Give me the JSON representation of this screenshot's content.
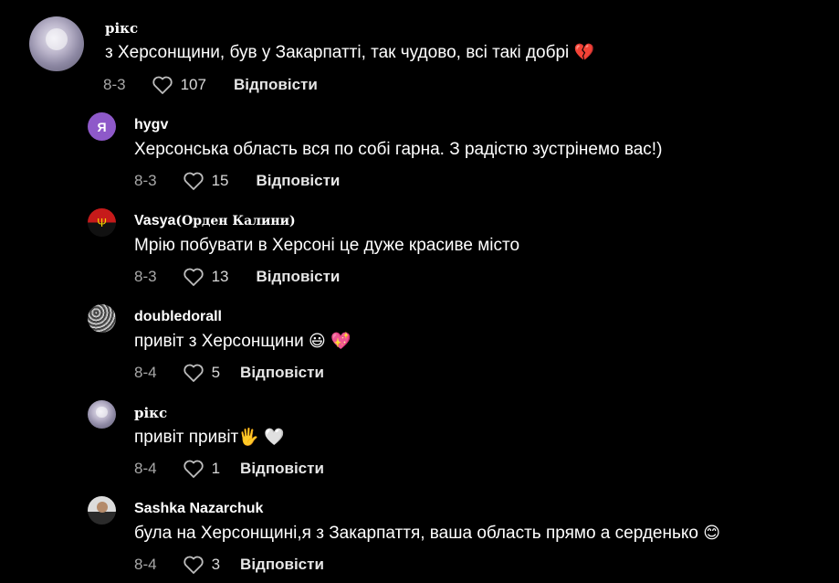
{
  "comments": [
    {
      "user": "рікс",
      "text": "з Херсонщини, був у Закарпатті, так чудово, всі такі добрі",
      "emoji": "💔",
      "date": "8-3",
      "likes": "107",
      "reply": "Відповісти"
    },
    {
      "user": "hygv",
      "avatar_letter": "Я",
      "text": "Херсонська область вся по собі гарна. З радістю зустрінемо вас!)",
      "date": "8-3",
      "likes": "15",
      "reply": "Відповісти"
    },
    {
      "user": "Vasya",
      "user_extra": "(Орден Калини)",
      "text": "Мрію побувати в Херсоні це дуже красиве місто",
      "date": "8-3",
      "likes": "13",
      "reply": "Відповісти"
    },
    {
      "user": "doubledorall",
      "text": "привіт з Херсонщини",
      "emoji1": "😃",
      "emoji2": "💖",
      "date": "8-4",
      "likes": "5",
      "reply": "Відповісти"
    },
    {
      "user": "рікс",
      "text": "привіт привіт",
      "emoji1": "🖐",
      "emoji2": "🤍",
      "date": "8-4",
      "likes": "1",
      "reply": "Відповісти"
    },
    {
      "user": "Sashka Nazarchuk",
      "text": "була на Херсонщині,я з Закарпаття, ваша область прямо а серденько",
      "emoji": "😊",
      "date": "8-4",
      "likes": "3",
      "reply": "Відповісти"
    }
  ],
  "colors": {
    "background": "#000000",
    "meta": "#a8a8a8",
    "text": "#ffffff",
    "avatar_ya": "#8e59c9"
  },
  "icons": {
    "like": "heart-outline-icon"
  }
}
